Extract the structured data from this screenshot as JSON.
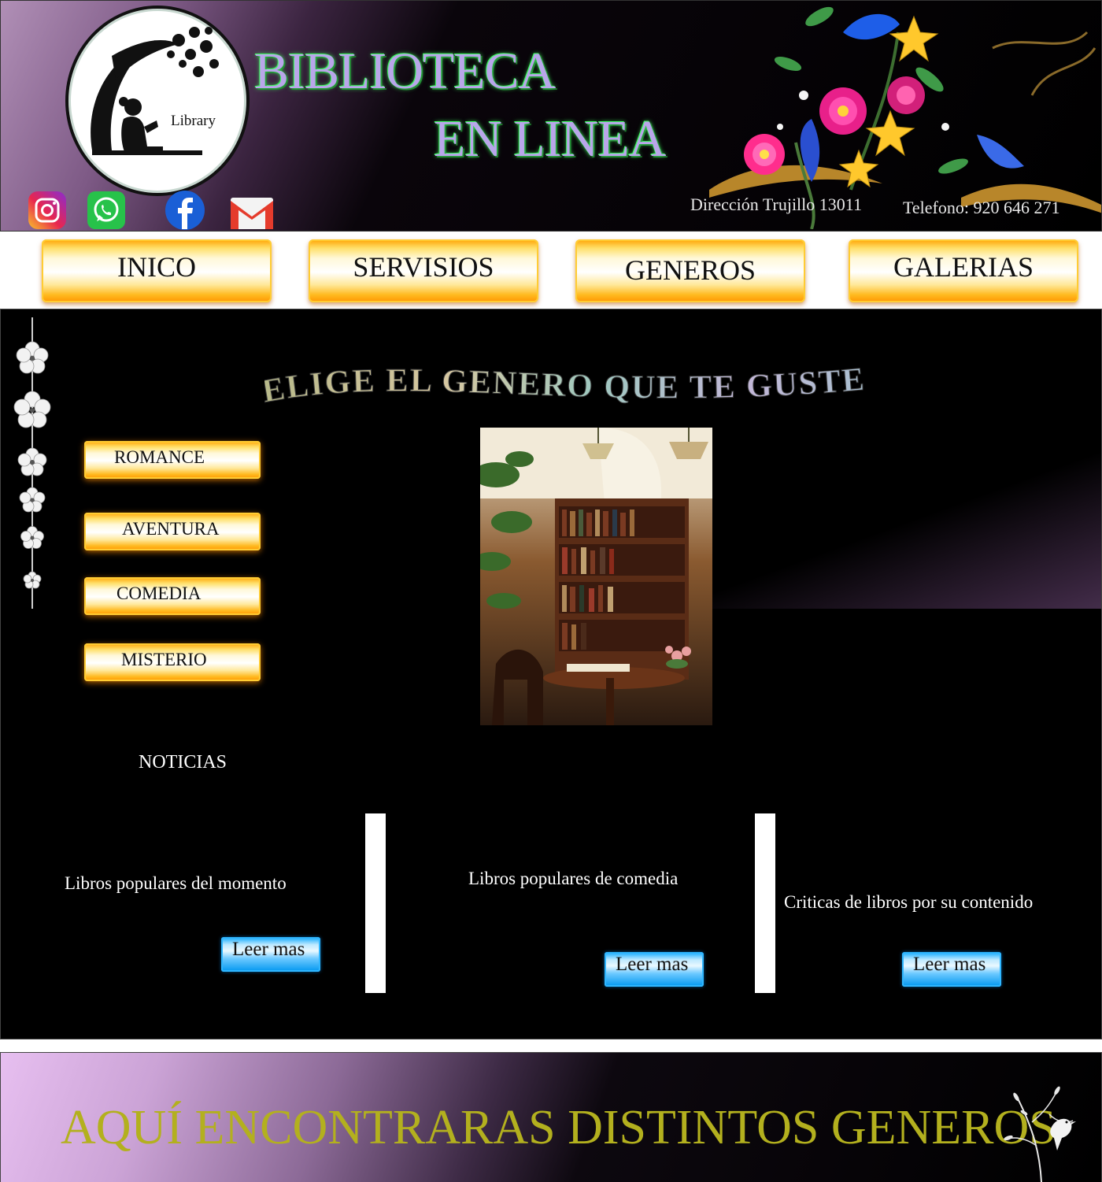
{
  "header": {
    "logo_label": "Library",
    "title_line1": "BIBLIOTECA",
    "title_line2": "EN LINEA",
    "social": [
      "instagram-icon",
      "whatsapp-icon",
      "facebook-icon",
      "gmail-icon"
    ],
    "address": "Dirección Trujillo 13011",
    "phone": "Telefono: 920 646 271"
  },
  "nav": [
    {
      "label": "INICO"
    },
    {
      "label": "SERVISIOS"
    },
    {
      "label": "GENEROS"
    },
    {
      "label": "GALERIAS"
    }
  ],
  "main": {
    "headline": "ELIGE EL GENERO QUE TE GUSTE",
    "genres": [
      "ROMANCE",
      "AVENTURA",
      "COMEDIA",
      "MISTERIO"
    ],
    "news_heading": "NOTICIAS",
    "news": [
      {
        "text": "Libros populares del momento",
        "button": "Leer mas"
      },
      {
        "text": "Libros populares de comedia",
        "button": "Leer mas"
      },
      {
        "text": "Criticas de libros por su contenido",
        "button": "Leer mas"
      }
    ]
  },
  "footer": {
    "tagline": "AQUÍ ENCONTRARAS DISTINTOS GENEROS"
  },
  "colors": {
    "title_fill": "#b9a6ea",
    "title_glow": "#38f056",
    "nav_gold": "#ffa200",
    "button_blue": "#0096f0",
    "footer_text": "#b3b01e"
  }
}
